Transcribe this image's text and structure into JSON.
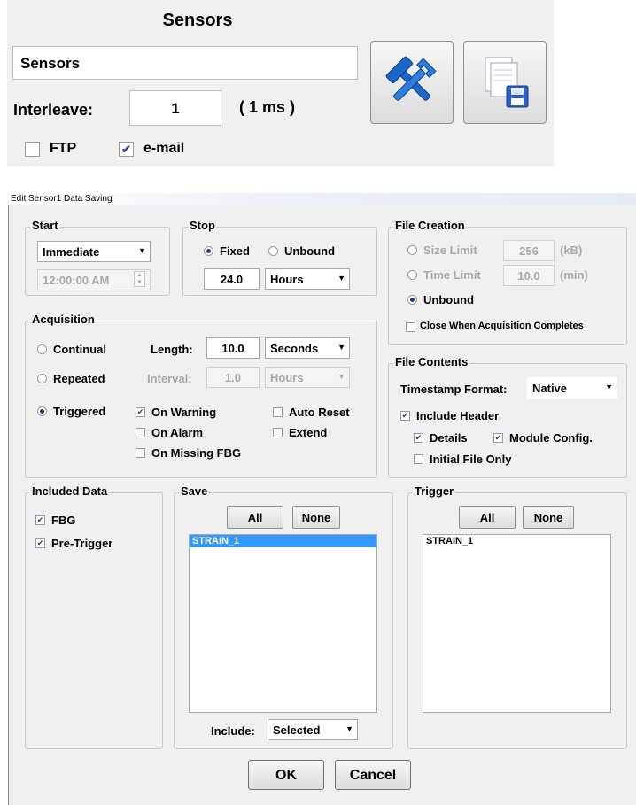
{
  "top": {
    "title": "Sensors",
    "name_value": "Sensors",
    "interleave_label": "Interleave:",
    "interleave_value": "1",
    "interleave_unit": "( 1 ms )",
    "ftp_label": "FTP",
    "ftp_checked": false,
    "email_label": "e-mail",
    "email_checked": true,
    "tools_icon": "tools-icon",
    "save_icon": "save-file-icon"
  },
  "dialog": {
    "title": "Edit Sensor1 Data Saving",
    "start": {
      "label": "Start",
      "mode": "Immediate",
      "time": "12:00:00 AM"
    },
    "stop": {
      "label": "Stop",
      "fixed_label": "Fixed",
      "unbound_label": "Unbound",
      "selected": "Fixed",
      "value": "24.0",
      "unit": "Hours"
    },
    "file_creation": {
      "label": "File Creation",
      "size_limit_label": "Size Limit",
      "size_limit_value": "256",
      "size_limit_unit": "(kB)",
      "time_limit_label": "Time Limit",
      "time_limit_value": "10.0",
      "time_limit_unit": "(min)",
      "unbound_label": "Unbound",
      "selected": "Unbound",
      "close_when_label": "Close When Acquisition Completes",
      "close_when_checked": false
    },
    "acquisition": {
      "label": "Acquisition",
      "continual_label": "Continual",
      "repeated_label": "Repeated",
      "triggered_label": "Triggered",
      "selected": "Triggered",
      "length_label": "Length:",
      "length_value": "10.0",
      "length_unit": "Seconds",
      "interval_label": "Interval:",
      "interval_value": "1.0",
      "interval_unit": "Hours",
      "on_warning_label": "On Warning",
      "on_warning_checked": true,
      "on_alarm_label": "On Alarm",
      "on_alarm_checked": false,
      "on_missing_label": "On Missing FBG",
      "on_missing_checked": false,
      "auto_reset_label": "Auto Reset",
      "auto_reset_checked": false,
      "extend_label": "Extend",
      "extend_checked": false
    },
    "file_contents": {
      "label": "File Contents",
      "timestamp_label": "Timestamp Format:",
      "timestamp_value": "Native",
      "include_header_label": "Include Header",
      "include_header_checked": true,
      "details_label": "Details",
      "details_checked": true,
      "module_config_label": "Module Config.",
      "module_config_checked": true,
      "initial_file_label": "Initial File Only",
      "initial_file_checked": false
    },
    "included_data": {
      "label": "Included Data",
      "fbg_label": "FBG",
      "fbg_checked": true,
      "pretrigger_label": "Pre-Trigger",
      "pretrigger_checked": true
    },
    "save": {
      "label": "Save",
      "all_label": "All",
      "none_label": "None",
      "items": [
        "STRAIN_1"
      ],
      "include_label": "Include:",
      "include_value": "Selected"
    },
    "trigger": {
      "label": "Trigger",
      "all_label": "All",
      "none_label": "None",
      "items": [
        "STRAIN_1"
      ]
    },
    "ok_label": "OK",
    "cancel_label": "Cancel"
  }
}
